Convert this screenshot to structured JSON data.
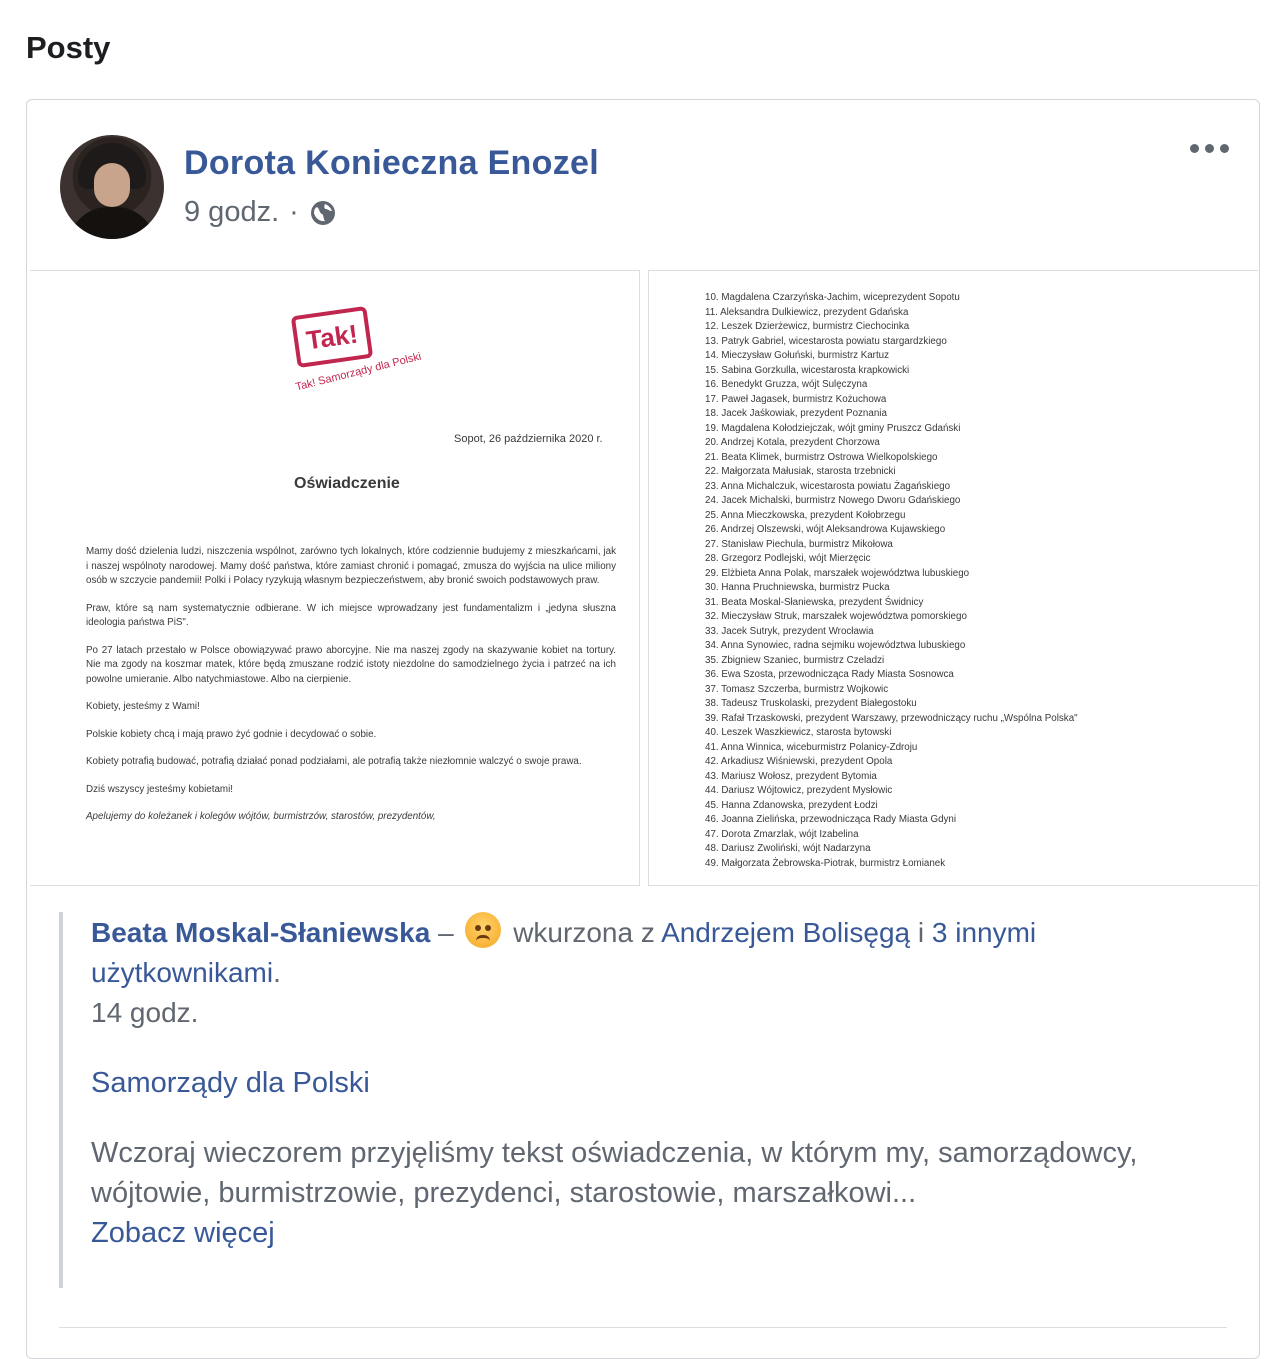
{
  "section": {
    "title": "Posty"
  },
  "post": {
    "author": "Dorota Konieczna Enozel",
    "time": "9 godz.",
    "separator": "·",
    "photos": {
      "left": {
        "logo_text": "Tak!",
        "logo_sub": "Tak! Samorządy dla Polski",
        "date": "Sopot, 26 października 2020 r.",
        "heading": "Oświadczenie",
        "paragraphs": [
          "Mamy dość dzielenia ludzi, niszczenia wspólnot, zarówno tych lokalnych, które codziennie budujemy z mieszkańcami, jak i naszej wspólnoty narodowej. Mamy dość państwa, które zamiast chronić i pomagać, zmusza do wyjścia na ulice miliony osób w szczycie pandemii! Polki i Polacy ryzykują własnym bezpieczeństwem, aby bronić swoich podstawowych praw.",
          "Praw, które są nam systematycznie odbierane. W ich miejsce wprowadzany jest fundamentalizm i „jedyna słuszna ideologia państwa PiS\".",
          "Po 27 latach przestało w Polsce obowiązywać prawo aborcyjne. Nie ma naszej zgody na skazywanie kobiet na tortury. Nie ma zgody na koszmar matek, które będą zmuszane rodzić istoty niezdolne do samodzielnego życia i patrzeć na ich powolne umieranie. Albo natychmiastowe. Albo na cierpienie.",
          "Kobiety, jesteśmy z Wami!",
          "Polskie kobiety chcą i mają prawo żyć godnie i decydować o sobie.",
          "Kobiety potrafią budować, potrafią działać ponad podziałami, ale potrafią także niezłomnie walczyć o swoje prawa.",
          "Dziś wszyscy jesteśmy kobietami!",
          "Apelujemy do koleżanek i kolegów wójtów, burmistrzów, starostów, prezydentów,"
        ]
      },
      "right": {
        "list": [
          "10. Magdalena Czarzyńska-Jachim, wiceprezydent Sopotu",
          "11. Aleksandra Dulkiewicz, prezydent Gdańska",
          "12. Leszek Dzierżewicz, burmistrz Ciechocinka",
          "13. Patryk Gabriel, wicestarosta powiatu stargardzkiego",
          "14. Mieczysław Gołuński, burmistrz Kartuz",
          "15. Sabina Gorzkulla, wicestarosta krapkowicki",
          "16. Benedykt Gruzza, wójt Sulęczyna",
          "17. Paweł Jagasek, burmistrz Kożuchowa",
          "18. Jacek Jaśkowiak, prezydent Poznania",
          "19. Magdalena Kołodziejczak, wójt gminy Pruszcz Gdański",
          "20. Andrzej Kotala, prezydent Chorzowa",
          "21. Beata Klimek, burmistrz Ostrowa Wielkopolskiego",
          "22. Małgorzata Małusiak, starosta trzebnicki",
          "23. Anna Michalczuk, wicestarosta powiatu Żagańskiego",
          "24. Jacek Michalski, burmistrz Nowego Dworu Gdańskiego",
          "25. Anna Mieczkowska, prezydent Kołobrzegu",
          "26. Andrzej Olszewski, wójt Aleksandrowa Kujawskiego",
          "27. Stanisław Piechula, burmistrz Mikołowa",
          "28. Grzegorz Podlejski, wójt Mierzęcic",
          "29. Elżbieta Anna Polak, marszałek województwa lubuskiego",
          "30. Hanna Pruchniewska, burmistrz Pucka",
          "31. Beata Moskal-Słaniewska, prezydent Świdnicy",
          "32. Mieczysław Struk, marszałek województwa pomorskiego",
          "33. Jacek Sutryk, prezydent Wrocławia",
          "34. Anna Synowiec, radna sejmiku województwa lubuskiego",
          "35. Zbigniew Szaniec, burmistrz Czeladzi",
          "36. Ewa Szosta, przewodnicząca Rady Miasta Sosnowca",
          "37. Tomasz Szczerba, burmistrz Wojkowic",
          "38. Tadeusz Truskolaski, prezydent Białegostoku",
          "39. Rafał Trzaskowski, prezydent Warszawy, przewodniczący ruchu „Wspólna Polska\"",
          "40. Leszek Waszkiewicz, starosta bytowski",
          "41. Anna Winnica, wiceburmistrz Polanicy-Zdroju",
          "42. Arkadiusz Wiśniewski, prezydent Opola",
          "43. Mariusz Wołosz, prezydent Bytomia",
          "44. Dariusz Wójtowicz, prezydent Mysłowic",
          "45. Hanna Zdanowska, prezydent Łodzi",
          "46. Joanna Zielińska, przewodnicząca Rady Miasta Gdyni",
          "47. Dorota Zmarzlak, wójt Izabelina",
          "48. Dariusz Zwoliński, wójt Nadarzyna",
          "49. Małgorzata Żebrowska-Piotrak, burmistrz Łomianek"
        ]
      }
    },
    "shared": {
      "name": "Beata Moskal-Słaniewska",
      "dash": "–",
      "feeling": "wkurzona z",
      "tagged": "Andrzejem Bolisęgą",
      "conj": "i",
      "others": "3 innymi użytkownikami",
      "period": ".",
      "time": "14 godz.",
      "title": "Samorządy dla Polski",
      "body": "Wczoraj wieczorem przyjęliśmy tekst oświadczenia, w którym my, samorządowcy, wójtowie, burmistrzowie, prezydenci, starostowie, marszałkowi...",
      "more": "Zobacz więcej"
    }
  }
}
